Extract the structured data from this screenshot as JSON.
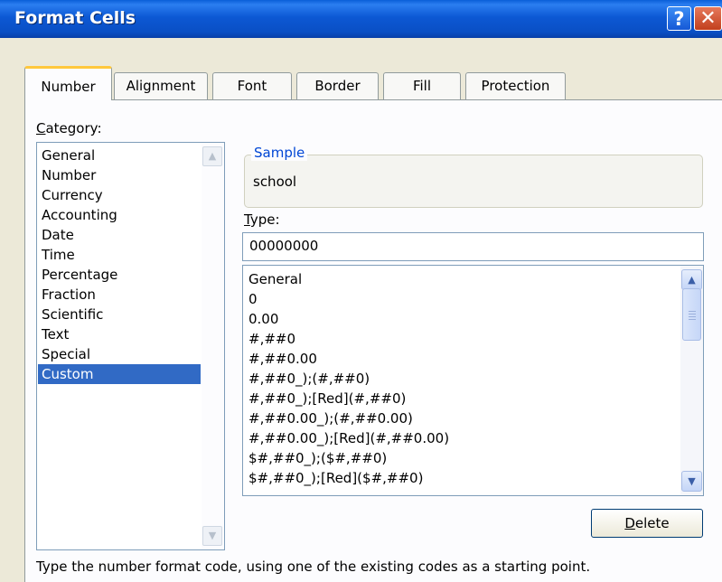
{
  "window": {
    "title": "Format Cells",
    "help_symbol": "?",
    "close_symbol": "✕"
  },
  "tabs": [
    {
      "label": "Number",
      "active": true
    },
    {
      "label": "Alignment",
      "active": false
    },
    {
      "label": "Font",
      "active": false
    },
    {
      "label": "Border",
      "active": false
    },
    {
      "label": "Fill",
      "active": false
    },
    {
      "label": "Protection",
      "active": false
    }
  ],
  "category": {
    "label_prefix": "",
    "label_mnemonic": "C",
    "label_rest": "ategory:",
    "items": [
      "General",
      "Number",
      "Currency",
      "Accounting",
      "Date",
      "Time",
      "Percentage",
      "Fraction",
      "Scientific",
      "Text",
      "Special",
      "Custom"
    ],
    "selected": "Custom"
  },
  "sample": {
    "legend": "Sample",
    "value": "school"
  },
  "type": {
    "label_mnemonic": "T",
    "label_rest": "ype:",
    "value": "00000000",
    "formats": [
      "General",
      "0",
      "0.00",
      "#,##0",
      "#,##0.00",
      "#,##0_);(#,##0)",
      "#,##0_);[Red](#,##0)",
      "#,##0.00_);(#,##0.00)",
      "#,##0.00_);[Red](#,##0.00)",
      "$#,##0_);($#,##0)",
      "$#,##0_);[Red]($#,##0)"
    ]
  },
  "delete_button": {
    "mnemonic": "D",
    "rest": "elete"
  },
  "hint": "Type the number format code, using one of the existing codes as a starting point.",
  "colors": {
    "titlebar": "#0a52cc",
    "selection": "#316ac5",
    "tab_highlight": "#ffc83c",
    "group_legend": "#0046d5"
  },
  "icons": {
    "scroll_up": "▲",
    "scroll_down": "▼"
  }
}
